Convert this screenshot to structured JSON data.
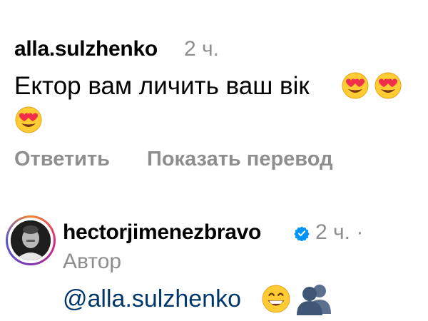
{
  "comment": {
    "username": "alla.sulzhenko",
    "time": "2 ч.",
    "text": "Ектор вам личить ваш вік",
    "emojis": [
      "heart-eyes-emoji",
      "heart-eyes-emoji",
      "heart-eyes-emoji"
    ],
    "actions": {
      "reply": "Ответить",
      "translate": "Показать перевод"
    }
  },
  "reply": {
    "username": "hectorjimenezbravo",
    "verified": true,
    "time": "2 ч. ·",
    "badge": "Автор",
    "mention": "@alla.sulzhenko",
    "emojis": [
      "grinning-face-emoji",
      "busts-in-silhouette-emoji"
    ]
  },
  "colors": {
    "secondary_text": "#8e8e8e",
    "mention": "#00376b",
    "verified": "#0095f6",
    "emoji_yellow": "#ffcc33",
    "heart_red": "#f0304a"
  }
}
